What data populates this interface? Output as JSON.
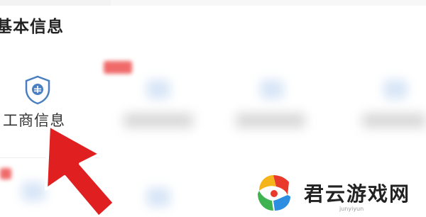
{
  "section": {
    "title": "基本信息"
  },
  "items": [
    {
      "label": "工商信息",
      "icon": "shield-badge-icon"
    }
  ],
  "watermark": {
    "brand": "君云游戏网",
    "sub": "junyiyun",
    "logo": "junyun-logo-icon"
  },
  "annotation": {
    "icon": "red-arrow-icon"
  },
  "colors": {
    "accent_red": "#e02020",
    "icon_blue": "#4a7fc1",
    "title_text": "#222222"
  }
}
